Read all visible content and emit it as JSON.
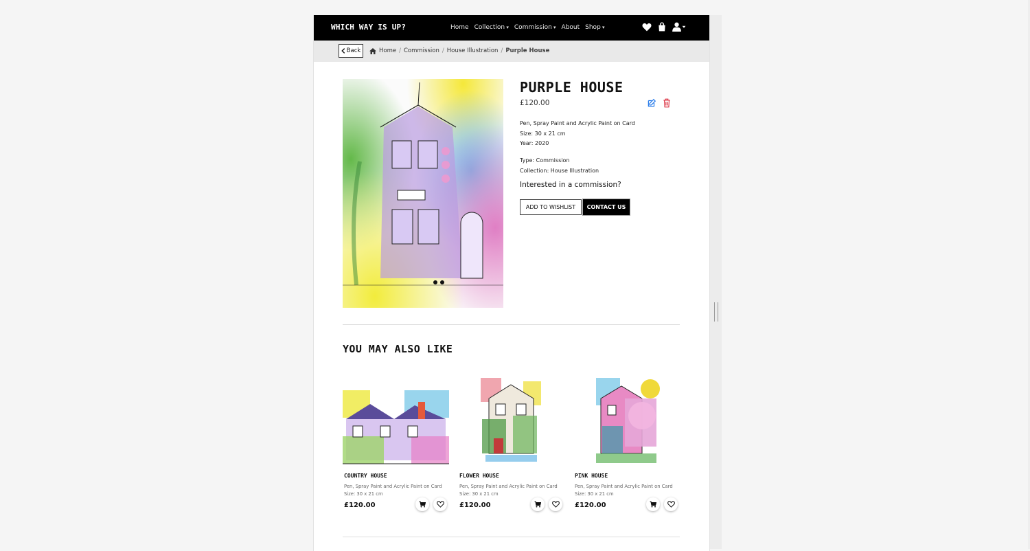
{
  "brand": "Which Way Is Up?",
  "nav": {
    "home": "Home",
    "collection": "Collection",
    "commission": "Commission",
    "about": "About",
    "shop": "Shop"
  },
  "icons": {
    "wishlist": "heart-icon",
    "bag": "shopping-bag-icon",
    "account": "user-icon"
  },
  "breadcrumb": {
    "back": "Back",
    "items": [
      "Home",
      "Commission",
      "House Illustration",
      "Purple House"
    ]
  },
  "product": {
    "title": "Purple House",
    "price": "£120.00",
    "medium": "Pen, Spray Paint and Acrylic Paint on Card",
    "size": "Size: 30 x 21 cm",
    "year": "Year: 2020",
    "type": "Type: Commission",
    "collection": "Collection: House Illustration",
    "cta_text": "Interested in a commission?",
    "wishlist_label": "Add to Wishlist",
    "contact_label": "Contact Us"
  },
  "also_like": {
    "heading": "You may also like",
    "items": [
      {
        "name": "Country House",
        "medium": "Pen, Spray Paint and Acrylic Paint on Card",
        "size": "Size: 30 x 21 cm",
        "price": "£120.00"
      },
      {
        "name": "Flower House",
        "medium": "Pen, Spray Paint and Acrylic Paint on Card",
        "size": "Size: 30 x 21 cm",
        "price": "£120.00"
      },
      {
        "name": "Pink House",
        "medium": "Pen, Spray Paint and Acrylic Paint on Card",
        "size": "Size: 30 x 21 cm",
        "price": "£120.00"
      }
    ]
  },
  "colors": {
    "edit": "#1a73e8",
    "delete": "#dc3545",
    "nav_bg": "#000000"
  }
}
